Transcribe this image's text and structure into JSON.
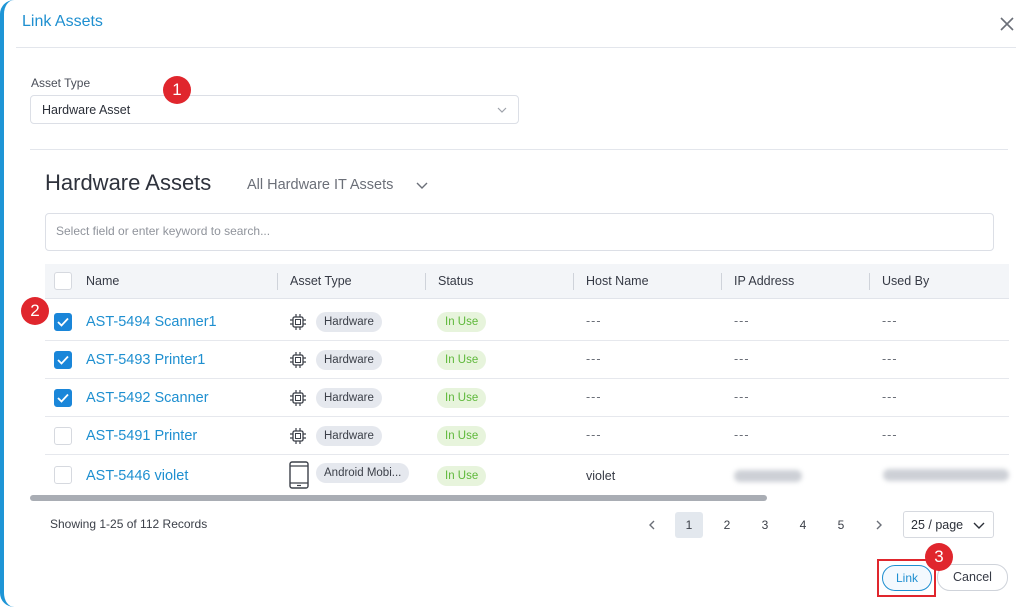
{
  "dialog": {
    "title": "Link Assets"
  },
  "asset_type": {
    "label": "Asset Type",
    "value": "Hardware Asset"
  },
  "section": {
    "title": "Hardware Assets",
    "filter": "All Hardware IT Assets"
  },
  "search": {
    "placeholder": "Select field or enter keyword to search..."
  },
  "table": {
    "columns": [
      "Name",
      "Asset Type",
      "Status",
      "Host Name",
      "IP Address",
      "Used By"
    ],
    "rows": [
      {
        "name": "AST-5494 Scanner1",
        "asset_type": "Hardware",
        "status": "In Use",
        "host": "---",
        "ip": "---",
        "used_by": "---",
        "checked": true,
        "icon": "chip-icon"
      },
      {
        "name": "AST-5493 Printer1",
        "asset_type": "Hardware",
        "status": "In Use",
        "host": "---",
        "ip": "---",
        "used_by": "---",
        "checked": true,
        "icon": "chip-icon"
      },
      {
        "name": "AST-5492 Scanner",
        "asset_type": "Hardware",
        "status": "In Use",
        "host": "---",
        "ip": "---",
        "used_by": "---",
        "checked": true,
        "icon": "chip-icon"
      },
      {
        "name": "AST-5491 Printer",
        "asset_type": "Hardware",
        "status": "In Use",
        "host": "---",
        "ip": "---",
        "used_by": "---",
        "checked": false,
        "icon": "chip-icon"
      },
      {
        "name": "AST-5446 violet",
        "asset_type": "Android Mobi...",
        "status": "In Use",
        "host": "violet",
        "checked": false,
        "icon": "mobile-icon"
      }
    ]
  },
  "pagination": {
    "summary": "Showing 1-25 of 112 Records",
    "pages": [
      "1",
      "2",
      "3",
      "4",
      "5"
    ],
    "current_page": "1",
    "per_page": "25 / page"
  },
  "buttons": {
    "link": "Link",
    "cancel": "Cancel"
  },
  "annotations": [
    "1",
    "2",
    "3"
  ],
  "colors": {
    "accent": "#1e8fd0",
    "checkbox": "#1a86d9",
    "status_green": "#5eb83a",
    "marker_red": "#e0262d"
  }
}
